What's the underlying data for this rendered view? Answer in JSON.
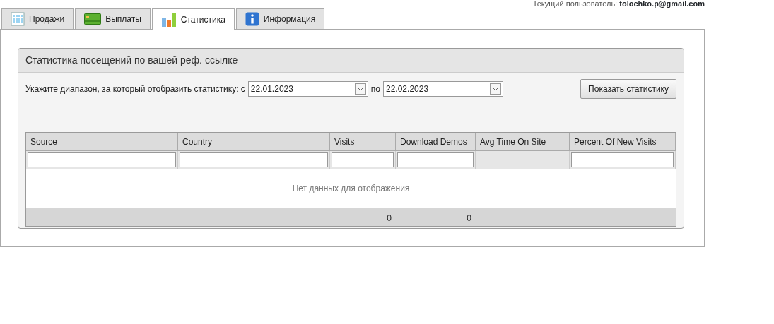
{
  "user": {
    "label": "Текущий пользователь:",
    "email": "tolochko.p@gmail.com"
  },
  "tabs": [
    {
      "label": "Продажи",
      "selected": false
    },
    {
      "label": "Выплаты",
      "selected": false
    },
    {
      "label": "Статистика",
      "selected": true
    },
    {
      "label": "Информация",
      "selected": false
    }
  ],
  "panel": {
    "title": "Статистика посещений по вашей реф. ссылке",
    "range_label": "Укажите диапазон, за который отобразить статистику: с",
    "date_from": "22.01.2023",
    "to_label": "по",
    "date_to": "22.02.2023",
    "button": "Показать статистику"
  },
  "table": {
    "columns": [
      {
        "label": "Source",
        "filter": true
      },
      {
        "label": "Country",
        "filter": true
      },
      {
        "label": "Visits",
        "filter": true,
        "total": "0"
      },
      {
        "label": "Download Demos",
        "filter": true,
        "total": "0"
      },
      {
        "label": "Avg Time On Site",
        "filter": false
      },
      {
        "label": "Percent Of New Visits",
        "filter": true
      }
    ],
    "empty_text": "Нет данных для отображения"
  }
}
